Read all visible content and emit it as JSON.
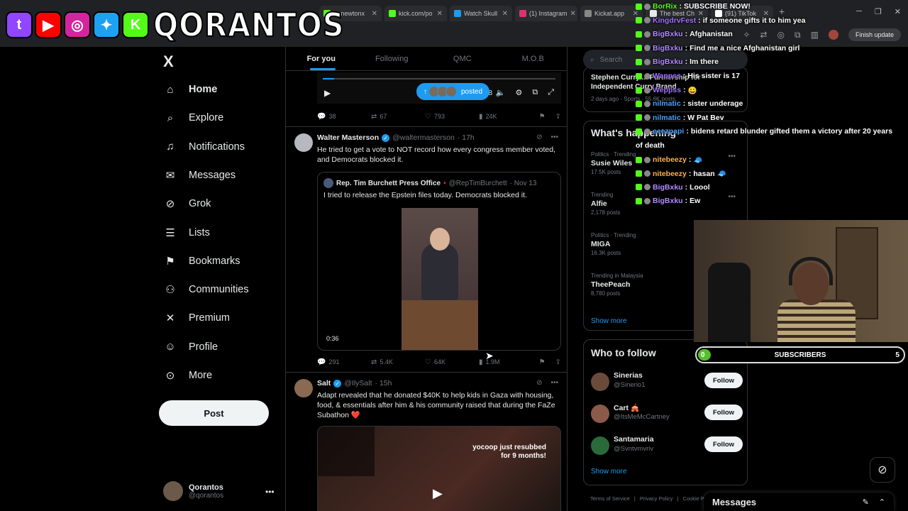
{
  "browser": {
    "tabs": [
      {
        "label": "mrnewtonx",
        "color": "#53fc18"
      },
      {
        "label": "kick.com/po",
        "color": "#53fc18"
      },
      {
        "label": "Watch Skull",
        "color": "#1d9bf0"
      },
      {
        "label": "(1) Instagram",
        "color": "#e1306c"
      },
      {
        "label": "Kickat.app",
        "color": "#888888"
      },
      {
        "label": "The best Ch",
        "color": "#e7e9ea"
      },
      {
        "label": "(91) TikTok",
        "color": "#ffffff"
      }
    ],
    "new_tab": "+",
    "finish_update": "Finish update"
  },
  "overlay": {
    "brand": "QORANTOS",
    "socials": [
      {
        "icon": "twitch-icon",
        "glyph": "t",
        "color": "#9146ff"
      },
      {
        "icon": "youtube-icon",
        "glyph": "▶",
        "color": "#ff0000"
      },
      {
        "icon": "instagram-icon",
        "glyph": "◎",
        "color": "#d6249f"
      },
      {
        "icon": "twitter-icon",
        "glyph": "✦",
        "color": "#1da1f2"
      },
      {
        "icon": "kick-icon",
        "glyph": "K",
        "color": "#53fc18"
      }
    ]
  },
  "nav": {
    "logo": "X",
    "items": [
      {
        "label": "Home",
        "icon": "home-icon",
        "glyph": "⌂",
        "active": true
      },
      {
        "label": "Explore",
        "icon": "search-icon",
        "glyph": "⌕"
      },
      {
        "label": "Notifications",
        "icon": "bell-icon",
        "glyph": "♫"
      },
      {
        "label": "Messages",
        "icon": "mail-icon",
        "glyph": "✉"
      },
      {
        "label": "Grok",
        "icon": "grok-icon",
        "glyph": "⊘"
      },
      {
        "label": "Lists",
        "icon": "list-icon",
        "glyph": "☰"
      },
      {
        "label": "Bookmarks",
        "icon": "bookmark-icon",
        "glyph": "⚑"
      },
      {
        "label": "Communities",
        "icon": "communities-icon",
        "glyph": "⚇"
      },
      {
        "label": "Premium",
        "icon": "x-premium-icon",
        "glyph": "✕"
      },
      {
        "label": "Profile",
        "icon": "profile-icon",
        "glyph": "☺"
      },
      {
        "label": "More",
        "icon": "more-icon",
        "glyph": "⊙"
      }
    ],
    "post": "Post",
    "account": {
      "name": "Qorantos",
      "handle": "@qorantos"
    }
  },
  "feed": {
    "tabs": [
      "For you",
      "Following",
      "QMC",
      "M.O.B"
    ],
    "video": {
      "time": "/ 0:28",
      "posted": "posted",
      "progress": 0.05
    },
    "top_actions": {
      "replies": "38",
      "reposts": "67",
      "likes": "793",
      "views": "24K"
    },
    "tweet1": {
      "name": "Walter Masterson",
      "handle": "@waltermasterson",
      "time": "· 17h",
      "text": "He tried to get a vote to NOT record how every congress member voted, and Democrats blocked it.",
      "quote": {
        "name": "Rep. Tim Burchett Press Office",
        "handle": "@RepTimBurchett",
        "time": "· Nov 13",
        "text": "I tried to release the Epstein files today. Democrats blocked it.",
        "duration": "0:36"
      },
      "actions": {
        "replies": "291",
        "reposts": "5.4K",
        "likes": "64K",
        "views": "1.9M"
      }
    },
    "tweet2": {
      "name": "Salt",
      "handle": "@IlySalt",
      "time": "· 15h",
      "text": "Adapt revealed that he donated $40K to help kids in Gaza with housing, food, & essentials after him & his community raised that during the FaZe Subathon ❤️",
      "media_caption_1": "yocoop just resubbed",
      "media_caption_2": "for 9 months!"
    }
  },
  "right": {
    "search_placeholder": "Search",
    "news": {
      "title": "Stephen Curry ... Partnership for Independent Curry Brand",
      "meta": "2 days ago · Sports · 55.6K posts"
    },
    "trends_title": "What's happening",
    "trends": [
      {
        "context": "Politics · Trending",
        "name": "Susie Wiles",
        "count": "17.5K posts"
      },
      {
        "context": "Trending",
        "name": "Alfie",
        "count": "2,178 posts"
      },
      {
        "context": "Politics · Trending",
        "name": "MIGA",
        "count": "16.3K posts"
      },
      {
        "context": "Trending in Malaysia",
        "name": "TheePeach",
        "count": "8,780 posts"
      }
    ],
    "show_more": "Show more",
    "wtf_title": "Who to follow",
    "who_to_follow": [
      {
        "name": "Sinerias",
        "handle": "@Sinerio1",
        "color": "#6a4a3a"
      },
      {
        "name": "Cart 🎪",
        "handle": "@ItsMeMcCartney",
        "color": "#8a5a4a"
      },
      {
        "name": "Santamaria",
        "handle": "@Svntvmvriv",
        "color": "#2a6a3a"
      }
    ],
    "follow": "Follow",
    "footer": [
      "Terms of Service",
      "|",
      "Privacy Policy",
      "|",
      "Cookie P"
    ]
  },
  "chat": [
    {
      "user": "BorRix",
      "msg": "SUBSCRIBE NOW!",
      "color": "#53fc18"
    },
    {
      "user": "KingdrvFest",
      "msg": "if someone gifts it to him yea",
      "color": "#a070ff"
    },
    {
      "user": "BigBxku",
      "msg": "Afghanistan",
      "color": "#b08aff"
    },
    {
      "user": "BigBxku",
      "msg": "Find me a nice Afghanistan girl",
      "color": "#b08aff"
    },
    {
      "user": "BigBxku",
      "msg": "Im there",
      "color": "#b08aff"
    },
    {
      "user": "Wappss",
      "msg": "His sister is 17",
      "color": "#a070ff"
    },
    {
      "user": "Weppss",
      "msg": "😀",
      "color": "#a070ff"
    },
    {
      "user": "nilmatic",
      "msg": "sister underage",
      "color": "#4aa0ff"
    },
    {
      "user": "nilmatic",
      "msg": "W Pat Bev",
      "color": "#4aa0ff"
    },
    {
      "user": "eeezpapi",
      "msg": "bidens retard blunder gifted them a victory after 20 years",
      "color": "#4aa0ff"
    },
    {
      "user": "",
      "msg": "of death",
      "color": "#ffffff"
    },
    {
      "user": "nitebeezy",
      "msg": "🧢",
      "color": "#ffb14a"
    },
    {
      "user": "nitebeezy",
      "msg": "hasan 🧢",
      "color": "#ffb14a"
    },
    {
      "user": "BigBxku",
      "msg": "Loool",
      "color": "#b08aff"
    },
    {
      "user": "BigBxku",
      "msg": "Ew",
      "color": "#b08aff"
    }
  ],
  "subs": {
    "current": "0",
    "label": "SUBSCRIBERS",
    "goal": "5",
    "progress": 0.0
  },
  "messages": {
    "title": "Messages"
  }
}
